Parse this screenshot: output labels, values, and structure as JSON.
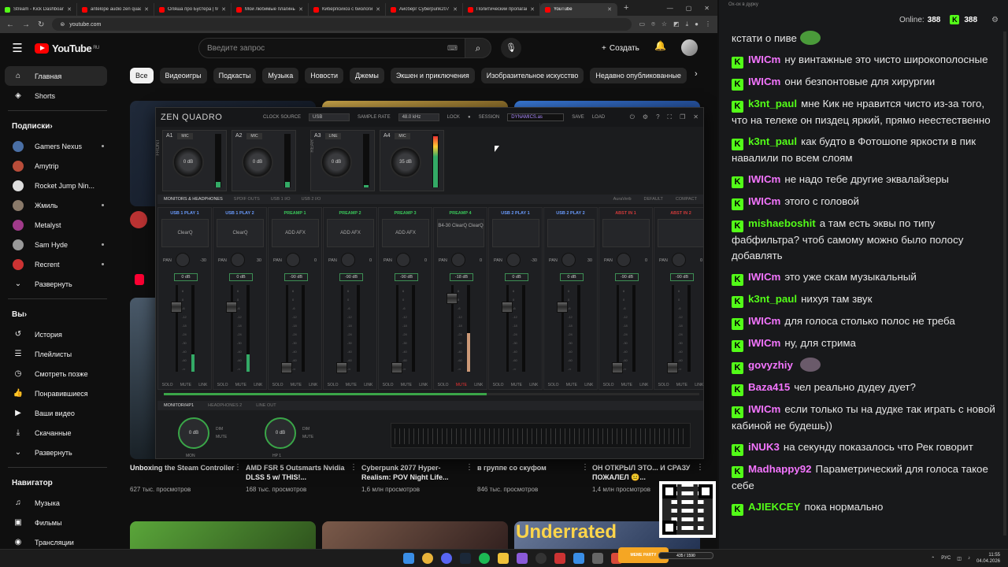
{
  "browser": {
    "tabs": [
      {
        "title": "Stream - Kick Dashboard",
        "color": "#53fc18"
      },
      {
        "title": "antelope audio zen quadro",
        "color": "#f00"
      },
      {
        "title": "Оляша про Бустера | Мне не ...",
        "color": "#f00"
      },
      {
        "title": "Мои любимые плагины...",
        "color": "#f00"
      },
      {
        "title": "Киберпсихоз с биологии...",
        "color": "#f00"
      },
      {
        "title": "Айсберг Cyberpunk2077...",
        "color": "#f00"
      },
      {
        "title": "Политический пропаганда...",
        "color": "#f00"
      },
      {
        "title": "YouTube",
        "color": "#f00",
        "active": true
      }
    ],
    "url": "youtube.com",
    "new_tab": "+"
  },
  "youtube": {
    "logo": "YouTube",
    "region": "RU",
    "search_placeholder": "Введите запрос",
    "create": "Создать",
    "chips": [
      "Все",
      "Видеоигры",
      "Подкасты",
      "Музыка",
      "Новости",
      "Джемы",
      "Экшен и приключения",
      "Изобразительное искусство",
      "Недавно опубликованные"
    ],
    "sidebar": {
      "main": [
        {
          "label": "Главная",
          "icon": "home-icon",
          "glyph": "⌂"
        },
        {
          "label": "Shorts",
          "icon": "shorts-icon",
          "glyph": "◈"
        }
      ],
      "subs_title": "Подписки",
      "subs": [
        {
          "label": "Gamers Nexus",
          "color": "#4a6fa5",
          "dot": true
        },
        {
          "label": "Amytrip",
          "color": "#b84d3a",
          "dot": false
        },
        {
          "label": "Rocket Jump Nin...",
          "color": "#ddd",
          "dot": true
        },
        {
          "label": "Жмиль",
          "color": "#8a7a6a",
          "dot": true
        },
        {
          "label": "Metalyst",
          "color": "#a03a8a",
          "dot": false
        },
        {
          "label": "Sam Hyde",
          "color": "#999",
          "dot": true
        },
        {
          "label": "Recrent",
          "color": "#c33",
          "dot": true
        },
        {
          "label": "Развернуть",
          "color": "",
          "dot": false
        }
      ],
      "you_title": "Вы",
      "you": [
        {
          "label": "История",
          "glyph": "↺"
        },
        {
          "label": "Плейлисты",
          "glyph": "☰"
        },
        {
          "label": "Смотреть позже",
          "glyph": "◷"
        },
        {
          "label": "Понравившиеся",
          "glyph": "👍"
        },
        {
          "label": "Ваши видео",
          "glyph": "▶"
        },
        {
          "label": "Скачанные",
          "glyph": "⤓"
        },
        {
          "label": "Развернуть",
          "glyph": "⌄"
        }
      ],
      "nav_title": "Навигатор",
      "nav": [
        {
          "label": "Музыка",
          "glyph": "♫"
        },
        {
          "label": "Фильмы",
          "glyph": "▣"
        },
        {
          "label": "Трансляции",
          "glyph": "◉"
        }
      ]
    },
    "videos": [
      {
        "title": "Unboxing the Steam Controller",
        "meta": "627 тыс. просмотров"
      },
      {
        "title": "AMD FSR 5 Outsmarts Nvidia DLSS 5 w/ THIS!...",
        "meta": "168 тыс. просмотров"
      },
      {
        "title": "Cyberpunk 2077 Hyper-Realism: POV Night Life...",
        "meta": "1,6 млн просмотров"
      },
      {
        "title": "в группе со скуфом",
        "meta": "846 тыс. просмотров"
      },
      {
        "title": "ОН ОТКРЫЛ ЭТО... И СРАЗУ ПОЖАЛЕЛ 😐...",
        "meta": "1,4 млн просмотров"
      }
    ],
    "lower_thumb_text": "Underrated"
  },
  "mixer": {
    "logo": "ZEN QUADRO",
    "clock_label": "CLOCK SOURCE",
    "clock": "USB",
    "rate_label": "SAMPLE RATE",
    "rate": "48.0 kHz",
    "lock": "LOCK",
    "session_label": "SESSION",
    "session": "DYNAMICS.as",
    "save": "SAVE",
    "load": "LOAD",
    "front": "FRONT",
    "rear": "REAR",
    "preamps": [
      {
        "name": "A1",
        "mode": "MIC",
        "gain": "0 dB",
        "level": 0.1
      },
      {
        "name": "A2",
        "mode": "MIC",
        "gain": "0 dB",
        "level": 0.1
      },
      {
        "name": "A3",
        "mode": "LINE",
        "gain": "0 dB",
        "level": 0.05
      },
      {
        "name": "A4",
        "mode": "MIC",
        "gain": "35 dB",
        "level": 0.95
      }
    ],
    "tabs": [
      "MONITORS & HEADPHONES",
      "SPDIF OUTS",
      "USB 1 I/O",
      "USB 2 I/O"
    ],
    "tabs_right": [
      "AuraVerb",
      "DEFAULT",
      "COMPACT"
    ],
    "strips": [
      {
        "name": "USB 1 PLAY 1",
        "color": "#6a9cff",
        "slot": "ClearQ",
        "pan_l": "PAN",
        "pan_r": "-30",
        "db": "0 dB",
        "fader": 0.75,
        "vu": 0.2
      },
      {
        "name": "USB 1 PLAY 2",
        "color": "#6a9cff",
        "slot": "ClearQ",
        "pan_l": "PAN",
        "pan_r": "30",
        "db": "0 dB",
        "fader": 0.75,
        "vu": 0.2
      },
      {
        "name": "PREAMP 1",
        "color": "#3ac75a",
        "slot": "ADD AFX",
        "pan_l": "PAN",
        "pan_r": "0",
        "db": "-90 dB",
        "fader": 0.05,
        "vu": 0
      },
      {
        "name": "PREAMP 2",
        "color": "#3ac75a",
        "slot": "ADD AFX",
        "pan_l": "PAN",
        "pan_r": "0",
        "db": "-90 dB",
        "fader": 0.05,
        "vu": 0
      },
      {
        "name": "PREAMP 3",
        "color": "#3ac75a",
        "slot": "ADD AFX",
        "pan_l": "PAN",
        "pan_r": "0",
        "db": "-90 dB",
        "fader": 0.05,
        "vu": 0
      },
      {
        "name": "PREAMP 4",
        "color": "#3ac75a",
        "slot": "B4-30 ClearQ ClearQ",
        "pan_l": "PAN",
        "pan_r": "0",
        "db": "-18 dB",
        "fader": 0.85,
        "vu": 0.45
      },
      {
        "name": "USB 2 PLAY 1",
        "color": "#6a9cff",
        "slot": "",
        "pan_l": "PAN",
        "pan_r": "-30",
        "db": "0 dB",
        "fader": 0.75,
        "vu": 0
      },
      {
        "name": "USB 2 PLAY 2",
        "color": "#6a9cff",
        "slot": "",
        "pan_l": "PAN",
        "pan_r": "30",
        "db": "0 dB",
        "fader": 0.75,
        "vu": 0
      },
      {
        "name": "ABST IN 1",
        "color": "#d03a3a",
        "slot": "",
        "pan_l": "PAN",
        "pan_r": "0",
        "db": "-90 dB",
        "fader": 0.05,
        "vu": 0
      },
      {
        "name": "ABST IN 2",
        "color": "#d03a3a",
        "slot": "",
        "pan_l": "PAN",
        "pan_r": "0",
        "db": "-90 dB",
        "fader": 0.05,
        "vu": 0
      }
    ],
    "strip_buttons": [
      "SOLO",
      "MUTE",
      "LINK"
    ],
    "mon_tabs": [
      "MONITOR/HP1",
      "HEADPHONES 2",
      "LINE OUT"
    ],
    "monitors": [
      {
        "name": "MON",
        "gain": "0 dB",
        "s1": "DIM",
        "s2": "MUTE"
      },
      {
        "name": "HP 1",
        "gain": "0 dB",
        "s1": "DIM",
        "s2": "MUTE"
      }
    ]
  },
  "overlay": {
    "meme": "MEME PARTY",
    "progress": "435 / 1590"
  },
  "taskbar": {
    "lang": "РУС",
    "time": "11:55",
    "date": "04.04.2026"
  },
  "chat": {
    "title": "Ох-ох в дурку",
    "online_label": "Online:",
    "online": "388",
    "followers": "388",
    "messages": [
      {
        "user": "",
        "text": "кстати о пиве",
        "color": "#fff",
        "badge": false,
        "emote": "#4a9a3a"
      },
      {
        "user": "IWICm",
        "text": "ну винтажные это чисто широкополосные",
        "color": "#f475ff",
        "badge": true
      },
      {
        "user": "IWICm",
        "text": "они безпонтовые для хирургии",
        "color": "#f475ff",
        "badge": true
      },
      {
        "user": "k3nt_paul",
        "text": "мне Кик не нравится чисто из-за того, что на телеке он пиздец яркий, прямо неестественно",
        "color": "#53fc18",
        "badge": true
      },
      {
        "user": "k3nt_paul",
        "text": "как будто в Фотошопе яркости в пик навалили по всем слоям",
        "color": "#53fc18",
        "badge": true
      },
      {
        "user": "IWICm",
        "text": "не надо тебе другие эквалайзеры",
        "color": "#f475ff",
        "badge": true
      },
      {
        "user": "IWICm",
        "text": "этого с головой",
        "color": "#f475ff",
        "badge": true
      },
      {
        "user": "mishaeboshit",
        "text": "а там есть эквы по типу фабфильтра? чтоб самому можно было полосу добавлять",
        "color": "#53fc18",
        "badge": true
      },
      {
        "user": "IWICm",
        "text": "это уже скам музыкальный",
        "color": "#f475ff",
        "badge": true
      },
      {
        "user": "k3nt_paul",
        "text": "нихуя там звук",
        "color": "#53fc18",
        "badge": true
      },
      {
        "user": "IWICm",
        "text": "для голоса столько полос не треба",
        "color": "#f475ff",
        "badge": true
      },
      {
        "user": "IWICm",
        "text": "ну, для стрима",
        "color": "#f475ff",
        "badge": true
      },
      {
        "user": "govyzhiy",
        "text": "",
        "color": "#f475ff",
        "badge": true,
        "emote": "#6a5a6a"
      },
      {
        "user": "Baza415",
        "text": "чел реально дудеу дует?",
        "color": "#f475ff",
        "badge": true
      },
      {
        "user": "IWICm",
        "text": "если только ты на дудке так играть с новой кабиной не будешь))",
        "color": "#f475ff",
        "badge": true
      },
      {
        "user": "iNUK3",
        "text": "на секунду показалось что Рек говорит",
        "color": "#f475ff",
        "badge": true
      },
      {
        "user": "Madhappy92",
        "text": "Параметрический для голоса такое себе",
        "color": "#f475ff",
        "badge": true
      },
      {
        "user": "AJIEKCEY",
        "text": "пока нормально",
        "color": "#53fc18",
        "badge": true
      }
    ]
  }
}
